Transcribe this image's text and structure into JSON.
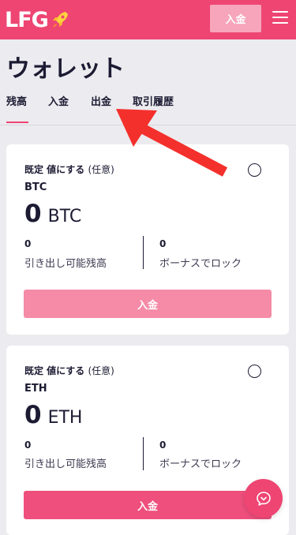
{
  "header": {
    "logo_text": "LFG",
    "deposit_label": "入金",
    "brand_color": "#ee4573"
  },
  "page": {
    "title": "ウォレット"
  },
  "tabs": [
    {
      "label": "残高",
      "active": true
    },
    {
      "label": "入金",
      "active": false
    },
    {
      "label": "出金",
      "active": false
    },
    {
      "label": "取引履歴",
      "active": false
    }
  ],
  "wallets": [
    {
      "set_default": "既定 値にする",
      "optional": "(任意)",
      "code": "BTC",
      "balance": "0",
      "currency": "BTC",
      "withdrawable_value": "0",
      "withdrawable_label": "引き出し可能残高",
      "bonus_value": "0",
      "bonus_label": "ボーナスでロック",
      "deposit_label": "入金"
    },
    {
      "set_default": "既定 値にする",
      "optional": "(任意)",
      "code": "ETH",
      "balance": "0",
      "currency": "ETH",
      "withdrawable_value": "0",
      "withdrawable_label": "引き出し可能残高",
      "bonus_value": "0",
      "bonus_label": "ボーナスでロック",
      "deposit_label": "入金"
    }
  ],
  "icons": {
    "logo": "rocket-icon",
    "menu": "hamburger-menu-icon",
    "chat": "chat-support-icon",
    "annotation": "red-arrow-annotation"
  }
}
